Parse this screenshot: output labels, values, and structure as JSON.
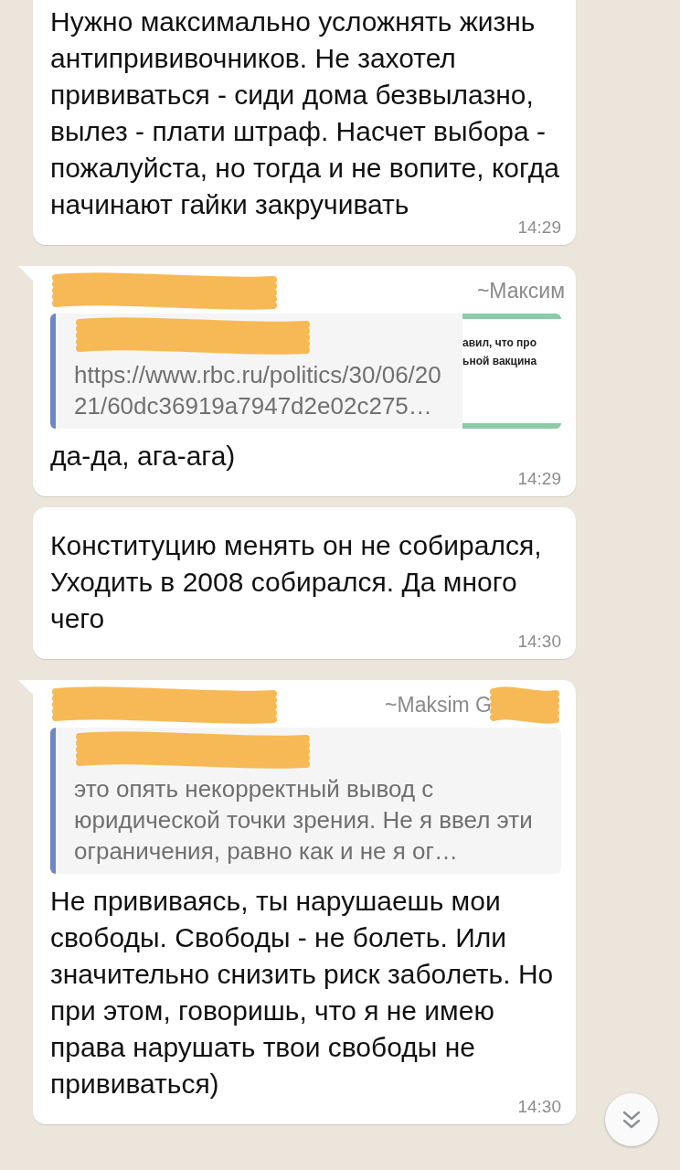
{
  "messages": [
    {
      "kind": "text",
      "tail": false,
      "text": "Нужно максимально усложнять жизнь антипрививочников. Не захотел прививаться - сиди дома безвылазно,  вылез - плати штраф. Насчет выбора - пожалуйста, но тогда и не вопите, когда начинают гайки закручивать",
      "time": "14:29"
    },
    {
      "kind": "reply",
      "tail": true,
      "sender_redacted": true,
      "push_name": "~Максим",
      "quote": {
        "sender_redacted": true,
        "text": "https://www.rbc.ru/politics/30/06/2021/60dc36919a7947d2e02c275…",
        "thumbnail_lines": [
          "авил, что про",
          "ьной вакцина"
        ]
      },
      "text": "да-да, ага-ага)",
      "time": "14:29"
    },
    {
      "kind": "text",
      "tail": false,
      "text": "Конституцию менять он не собирался, Уходить в 2008 собирался. Да много чего",
      "time": "14:30"
    },
    {
      "kind": "reply",
      "tail": true,
      "sender_redacted": true,
      "push_name": "~Maksim G",
      "push_name_redacted": true,
      "quote": {
        "sender_redacted": true,
        "text": "это опять некорректный вывод с юридической точки зрения. Не я ввел эти ограничения, равно как и не я ог…"
      },
      "text": "Не прививаясь, ты нарушаешь мои свободы. Свободы - не болеть. Или значительно снизить риск заболеть. Но при этом, говоришь, что я не имею права нарушать твои свободы не прививаться)",
      "time": "14:30"
    }
  ]
}
